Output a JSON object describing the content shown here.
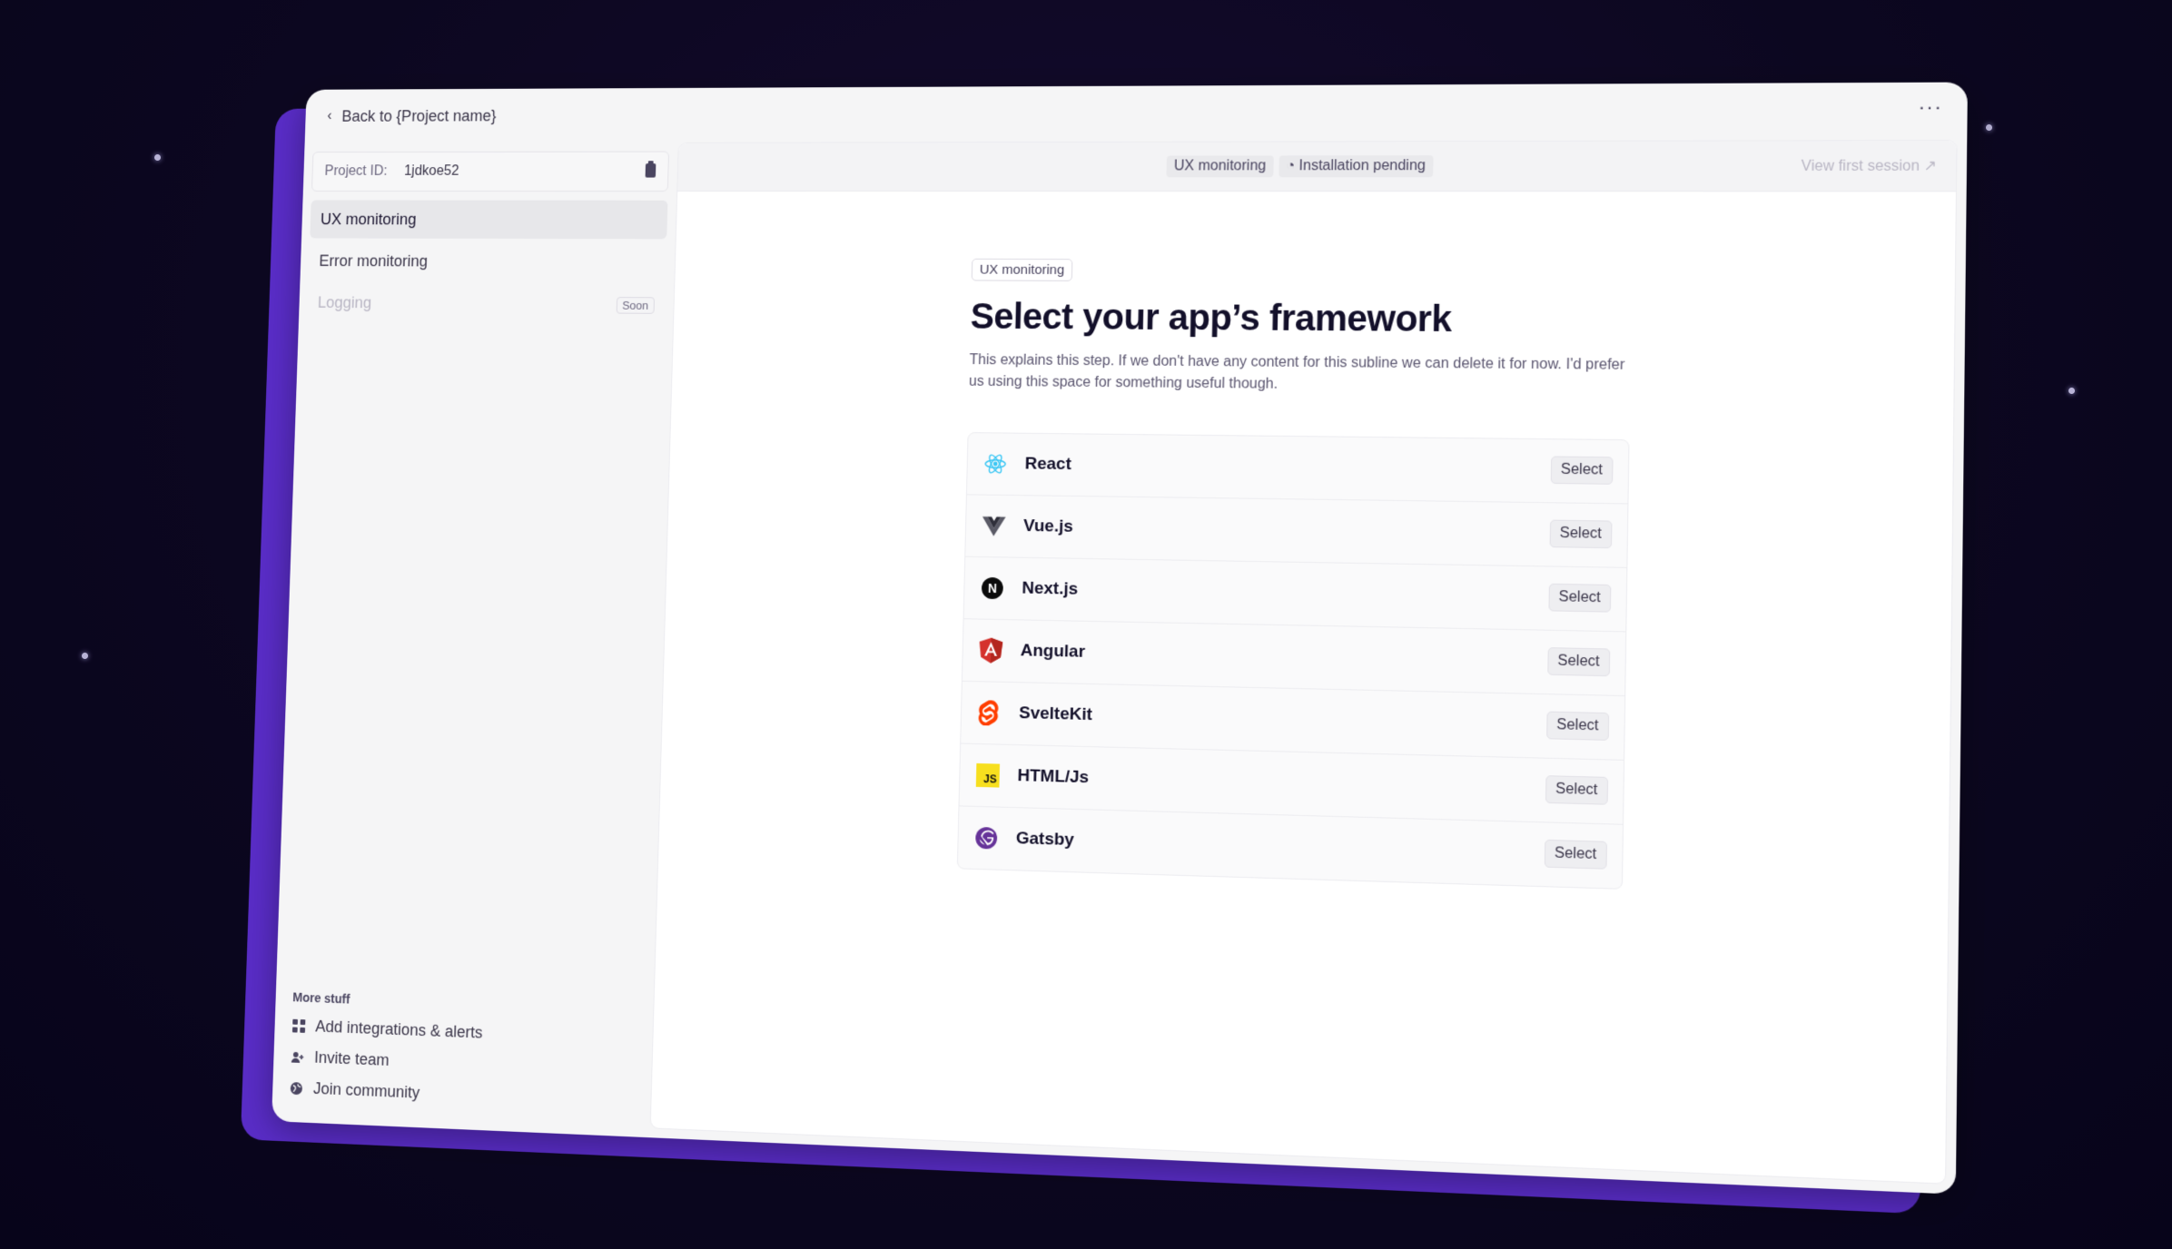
{
  "topbar": {
    "back_label": "Back to {Project name}",
    "more_label": "···"
  },
  "sidebar": {
    "project_id_label": "Project ID:",
    "project_id_value": "1jdkoe52",
    "items": [
      {
        "label": "UX monitoring"
      },
      {
        "label": "Error monitoring"
      },
      {
        "label": "Logging",
        "badge": "Soon"
      }
    ],
    "more_title": "More stuff",
    "more_items": [
      {
        "label": "Add integrations & alerts",
        "icon": "grid-icon"
      },
      {
        "label": "Invite team",
        "icon": "add-user-icon"
      },
      {
        "label": "Join community",
        "icon": "globe-icon"
      }
    ]
  },
  "header": {
    "crumb_1": "UX monitoring",
    "crumb_2": "Installation pending",
    "view_session": "View first session"
  },
  "main": {
    "tag": "UX monitoring",
    "title": "Select your app’s framework",
    "subline": "This explains this step. If we don't have any content for this subline we can delete it for now. I'd prefer us using this space for something useful though.",
    "frameworks": [
      {
        "name": "React",
        "icon": "react-icon",
        "button": "Select"
      },
      {
        "name": "Vue.js",
        "icon": "vue-icon",
        "button": "Select"
      },
      {
        "name": "Next.js",
        "icon": "next-icon",
        "button": "Select"
      },
      {
        "name": "Angular",
        "icon": "angular-icon",
        "button": "Select"
      },
      {
        "name": "SvelteKit",
        "icon": "svelte-icon",
        "button": "Select"
      },
      {
        "name": "HTML/Js",
        "icon": "js-icon",
        "button": "Select"
      },
      {
        "name": "Gatsby",
        "icon": "gatsby-icon",
        "button": "Select"
      }
    ]
  }
}
